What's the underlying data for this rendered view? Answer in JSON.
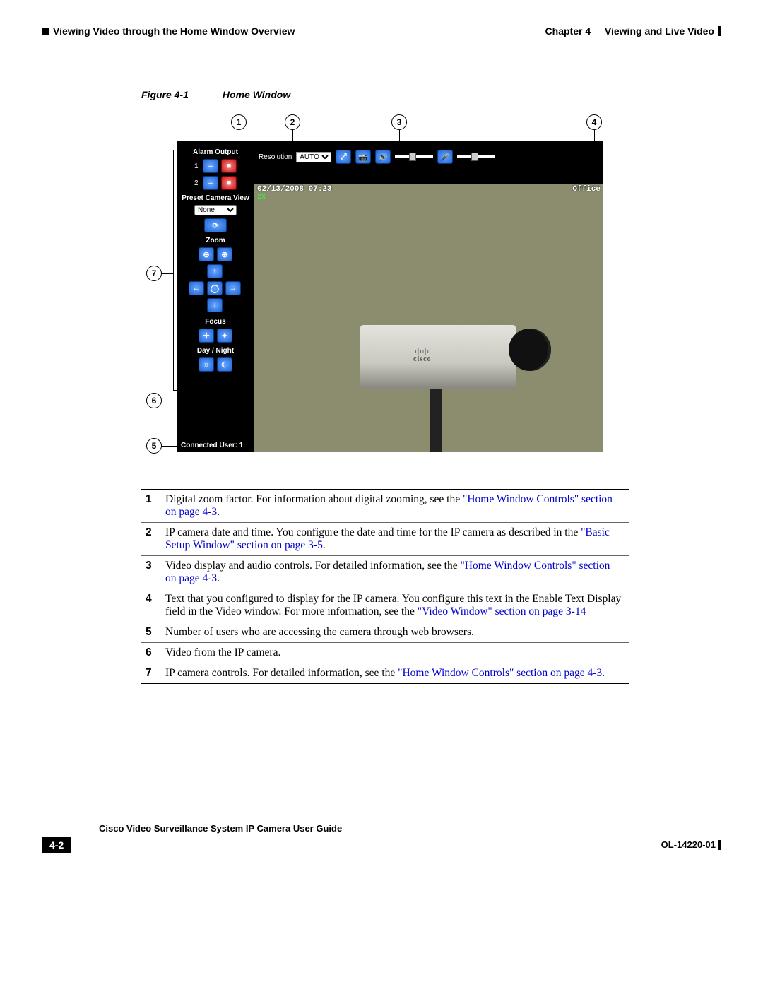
{
  "header": {
    "left": "Viewing Video through the Home Window Overview",
    "chapter": "Chapter 4",
    "title": "Viewing and Live Video"
  },
  "figure": {
    "label": "Figure 4-1",
    "caption": "Home Window",
    "callouts": [
      "1",
      "2",
      "3",
      "4",
      "5",
      "6",
      "7"
    ]
  },
  "ui": {
    "topbar": {
      "resolution_label": "Resolution",
      "resolution_value": "AUTO",
      "btn_zoom": "⤢",
      "btn_snapshot": "📷",
      "btn_audio": "🔊",
      "btn_mic": "🎤"
    },
    "video": {
      "timestamp": "02/13/2008 07:23",
      "zoom_factor": "2X",
      "banner": "Office",
      "camera_label": "cisco"
    },
    "side": {
      "alarm_title": "Alarm Output",
      "row1": "1",
      "row2": "2",
      "preset_title": "Preset Camera View",
      "preset_value": "None",
      "zoom_title": "Zoom",
      "focus_title": "Focus",
      "daynight_title": "Day / Night"
    },
    "connected": "Connected User: 1"
  },
  "table": [
    {
      "n": "1",
      "text": "Digital zoom factor. For information about digital zooming, see the ",
      "link": "\"Home Window Controls\" section on page 4-3",
      "suffix": "."
    },
    {
      "n": "2",
      "text": "IP camera date and time. You configure the date and time for the IP camera as described in the ",
      "link": "\"Basic Setup Window\" section on page 3-5",
      "suffix": "."
    },
    {
      "n": "3",
      "text": "Video display and audio controls. For detailed information, see the ",
      "link": "\"Home Window Controls\" section on page 4-3",
      "suffix": "."
    },
    {
      "n": "4",
      "text": "Text that you configured to display for the IP camera. You configure this text in the Enable Text Display field in the Video window. For more information, see the ",
      "link": "\"Video Window\" section on page 3-14",
      "suffix": ""
    },
    {
      "n": "5",
      "text": "Number of users who are accessing the camera through web browsers.",
      "link": "",
      "suffix": ""
    },
    {
      "n": "6",
      "text": "Video from the IP camera.",
      "link": "",
      "suffix": ""
    },
    {
      "n": "7",
      "text": "IP camera controls. For detailed information, see the ",
      "link": "\"Home Window Controls\" section on page 4-3",
      "suffix": "."
    }
  ],
  "footer": {
    "guide": "Cisco Video Surveillance System IP Camera User Guide",
    "pagenum": "4-2",
    "docid": "OL-14220-01"
  }
}
